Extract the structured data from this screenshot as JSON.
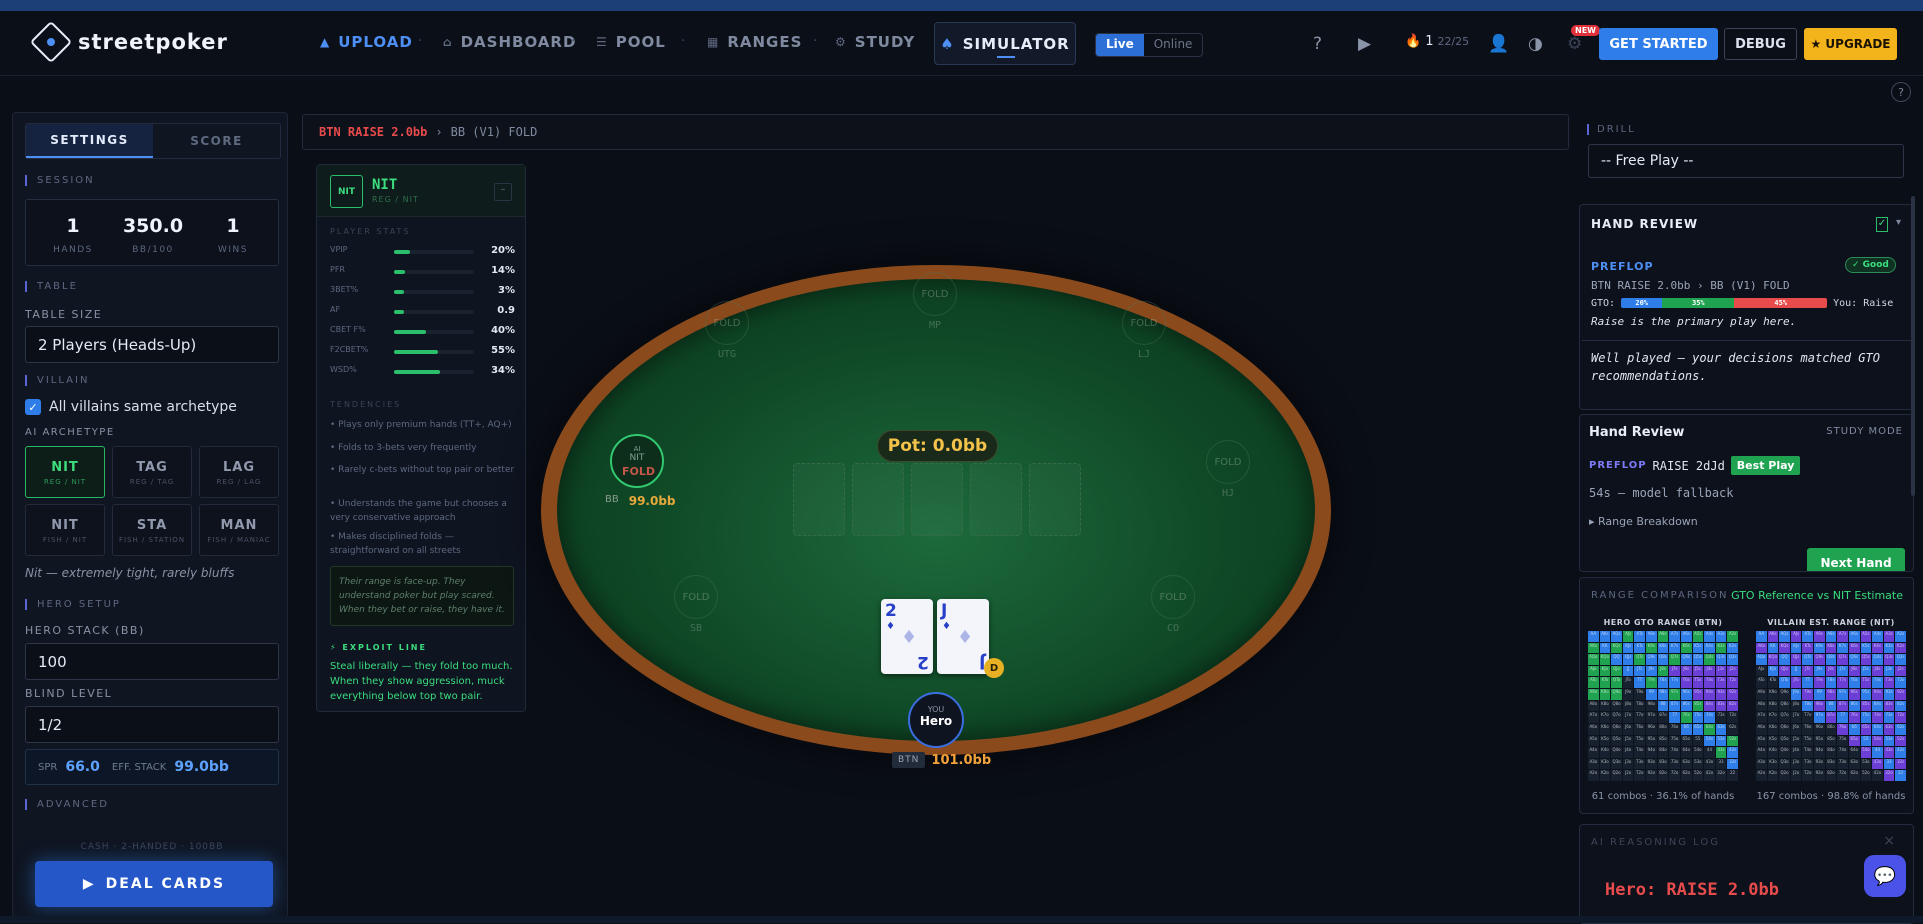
{
  "brand": {
    "name": "streetpoker"
  },
  "nav": {
    "items": [
      {
        "label": "UPLOAD",
        "icon": "upload-icon",
        "glyph": "▲",
        "color": "#4e8ff5"
      },
      {
        "label": "DASHBOARD",
        "icon": "home-icon",
        "glyph": "⌂",
        "color": "#7f8aa0"
      },
      {
        "label": "POOL",
        "icon": "list-icon",
        "glyph": "☰",
        "color": "#7f8aa0"
      },
      {
        "label": "RANGES",
        "icon": "grid-icon",
        "glyph": "▦",
        "color": "#7f8aa0"
      },
      {
        "label": "STUDY",
        "icon": "gear-icon",
        "glyph": "⚙",
        "color": "#7f8aa0"
      }
    ],
    "active": {
      "label": "SIMULATOR",
      "icon": "spade-icon"
    },
    "status_live": "Live",
    "status_online": "Online",
    "streak_count": "1",
    "streak_total": "22/25",
    "new_badge": "NEW",
    "get_started": "GET STARTED",
    "debug": "DEBUG",
    "upgrade": "★ UPGRADE",
    "help": "?"
  },
  "left": {
    "tabs": [
      "SETTINGS",
      "SCORE"
    ],
    "session_label": "SESSION",
    "stats": [
      {
        "value": "1",
        "label": "HANDS"
      },
      {
        "value": "350.0",
        "label": "BB/100"
      },
      {
        "value": "1",
        "label": "WINS"
      }
    ],
    "table_label": "TABLE",
    "table_size_label": "TABLE SIZE",
    "table_size": "2 Players (Heads-Up)",
    "villain_label": "VILLAIN",
    "same_archetype": "All villains same archetype",
    "ai_archetype_label": "AI ARCHETYPE",
    "archetypes": [
      {
        "name": "NIT",
        "sub": "REG / NIT"
      },
      {
        "name": "TAG",
        "sub": "REG / TAG"
      },
      {
        "name": "LAG",
        "sub": "REG / LAG"
      },
      {
        "name": "NIT",
        "sub": "FISH / NIT"
      },
      {
        "name": "STA",
        "sub": "FISH / STATION"
      },
      {
        "name": "MAN",
        "sub": "FISH / MANIAC"
      }
    ],
    "archetype_desc": "Nit — extremely tight, rarely bluffs",
    "hero_setup_label": "HERO SETUP",
    "hero_stack_label": "HERO STACK (BB)",
    "hero_stack": "100",
    "blind_label": "BLIND LEVEL",
    "blind": "1/2",
    "spr_label": "SPR",
    "spr": "66.0",
    "eff_label": "EFF. STACK",
    "eff": "99.0bb",
    "advanced_label": "ADVANCED",
    "faded_note": "CASH · 2-HANDED · 100BB",
    "deal": "DEAL CARDS"
  },
  "breadcrumb": {
    "first": "BTN RAISE 2.0bb",
    "sep": "›",
    "second": "BB (V1) FOLD"
  },
  "nit_panel": {
    "badge": "NIT",
    "title": "NIT",
    "sub": "REG / NIT",
    "collapse": "–",
    "stats_label": "PLAYER STATS",
    "stats": [
      {
        "label": "VPIP",
        "value": "20%",
        "pct": 20
      },
      {
        "label": "PFR",
        "value": "14%",
        "pct": 14
      },
      {
        "label": "3BET%",
        "value": "3%",
        "pct": 12
      },
      {
        "label": "AF",
        "value": "0.9",
        "pct": 12
      },
      {
        "label": "CBET F%",
        "value": "40%",
        "pct": 40
      },
      {
        "label": "F2CBET%",
        "value": "55%",
        "pct": 55
      },
      {
        "label": "WSD%",
        "value": "34%",
        "pct": 58
      }
    ],
    "tendencies_label": "TENDENCIES",
    "tendencies": [
      "Plays only premium hands (TT+, AQ+)",
      "Folds to 3-bets very frequently",
      "Rarely c-bets without top pair or better",
      "Understands the game but chooses a very conservative approach",
      "Makes disciplined folds — straightforward on all streets"
    ],
    "quote": "Their range is face-up. They understand poker but play scared. When they bet or raise, they have it.",
    "exploit_label": "EXPLOIT LINE",
    "exploit": "Steal liberally — they fold too much. When they show aggression, muck everything below top two pair."
  },
  "table": {
    "pot": "Pot: 0.0bb",
    "seats": [
      {
        "name": "FOLD",
        "pos": "UTG"
      },
      {
        "name": "FOLD",
        "pos": "MP"
      },
      {
        "name": "FOLD",
        "pos": "LJ"
      },
      {
        "name": "FOLD",
        "pos": "HJ"
      },
      {
        "name": "FOLD",
        "pos": "CO"
      },
      {
        "name": "FOLD",
        "pos": "SB"
      }
    ],
    "villain": {
      "ai": "AI",
      "name": "NIT",
      "status": "FOLD",
      "pos": "BB",
      "stack": "99.0bb"
    },
    "cards": [
      {
        "rank": "2",
        "suit": "♦"
      },
      {
        "rank": "J",
        "suit": "♦"
      }
    ],
    "dealer": "D",
    "hero": {
      "you": "YOU",
      "name": "Hero",
      "pos": "BTN",
      "stack": "101.0bb"
    }
  },
  "right": {
    "drill_label": "DRILL",
    "drill": "-- Free Play --",
    "review": {
      "title": "HAND REVIEW",
      "check": "✓",
      "caret": "▾",
      "street": "PREFLOP",
      "grade": "✓ Good",
      "action": "BTN RAISE 2.0bb › BB (V1) FOLD",
      "gto_label": "GTO:",
      "gto": [
        {
          "label": "20%",
          "pct": 20,
          "color": "#2f7de8"
        },
        {
          "label": "35%",
          "pct": 35,
          "color": "#20a350"
        },
        {
          "label": "45%",
          "pct": 45,
          "color": "#e84b4b"
        }
      ],
      "you": "You: Raise",
      "primary": "Raise is the primary play here.",
      "well": "Well played — your decisions matched GTO recommendations."
    },
    "review2": {
      "title": "Hand Review",
      "mode": "STUDY MODE",
      "street": "PREFLOP",
      "action": "RAISE 2dJd",
      "best": "Best Play",
      "fallback": "54s — model fallback",
      "breakdown": "▸ Range Breakdown",
      "next": "Next Hand"
    },
    "range": {
      "title": "RANGE COMPARISON",
      "legend": "GTO Reference vs NIT Estimate",
      "hero_title": "HERO GTO RANGE (BTN)",
      "villain_title": "VILLAIN EST. RANGE (NIT)",
      "hero_foot": "61 combos · 36.1% of hands",
      "villain_foot": "167 combos · 98.8% of hands"
    },
    "log": {
      "title": "AI REASONING LOG",
      "close": "×",
      "line": "Hero: RAISE 2.0bb"
    }
  }
}
